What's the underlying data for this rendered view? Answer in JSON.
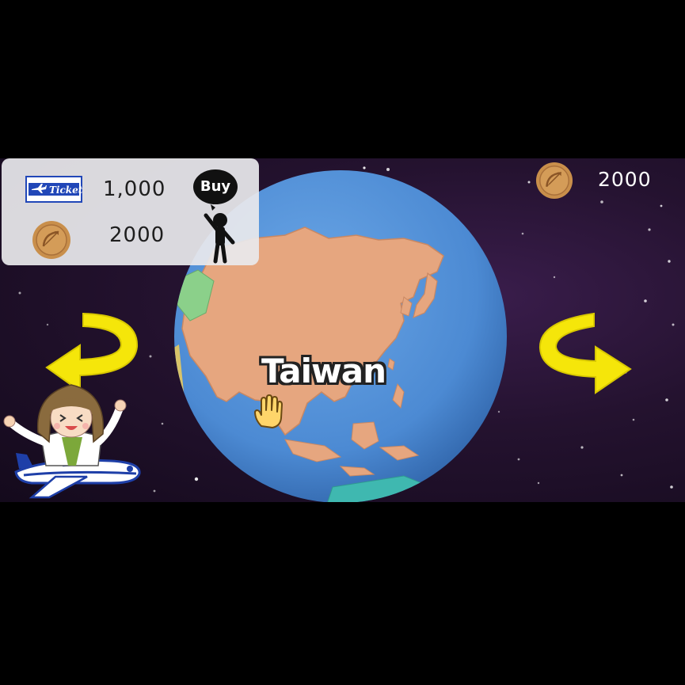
{
  "purchase_panel": {
    "ticket_icon_text": "Ticket",
    "ticket_price": "1,000",
    "coin_price": "2000",
    "buy_label": "Buy"
  },
  "hud": {
    "coin_count": "2000"
  },
  "globe": {
    "selected_country": "Taiwan"
  },
  "icons": {
    "ticket": "plane-ticket-icon",
    "coin": "bow-coin-icon",
    "buy": "buy-person-icon",
    "left": "curved-arrow-left-icon",
    "right": "curved-arrow-right-icon",
    "cursor": "hand-cursor-icon"
  },
  "colors": {
    "ocean": "#4f8fd6",
    "land": "#e6a67f",
    "arrow": "#f5e60a",
    "coin": "#c98f4b",
    "panel": "#e8e8ec",
    "space": "#24122f"
  }
}
